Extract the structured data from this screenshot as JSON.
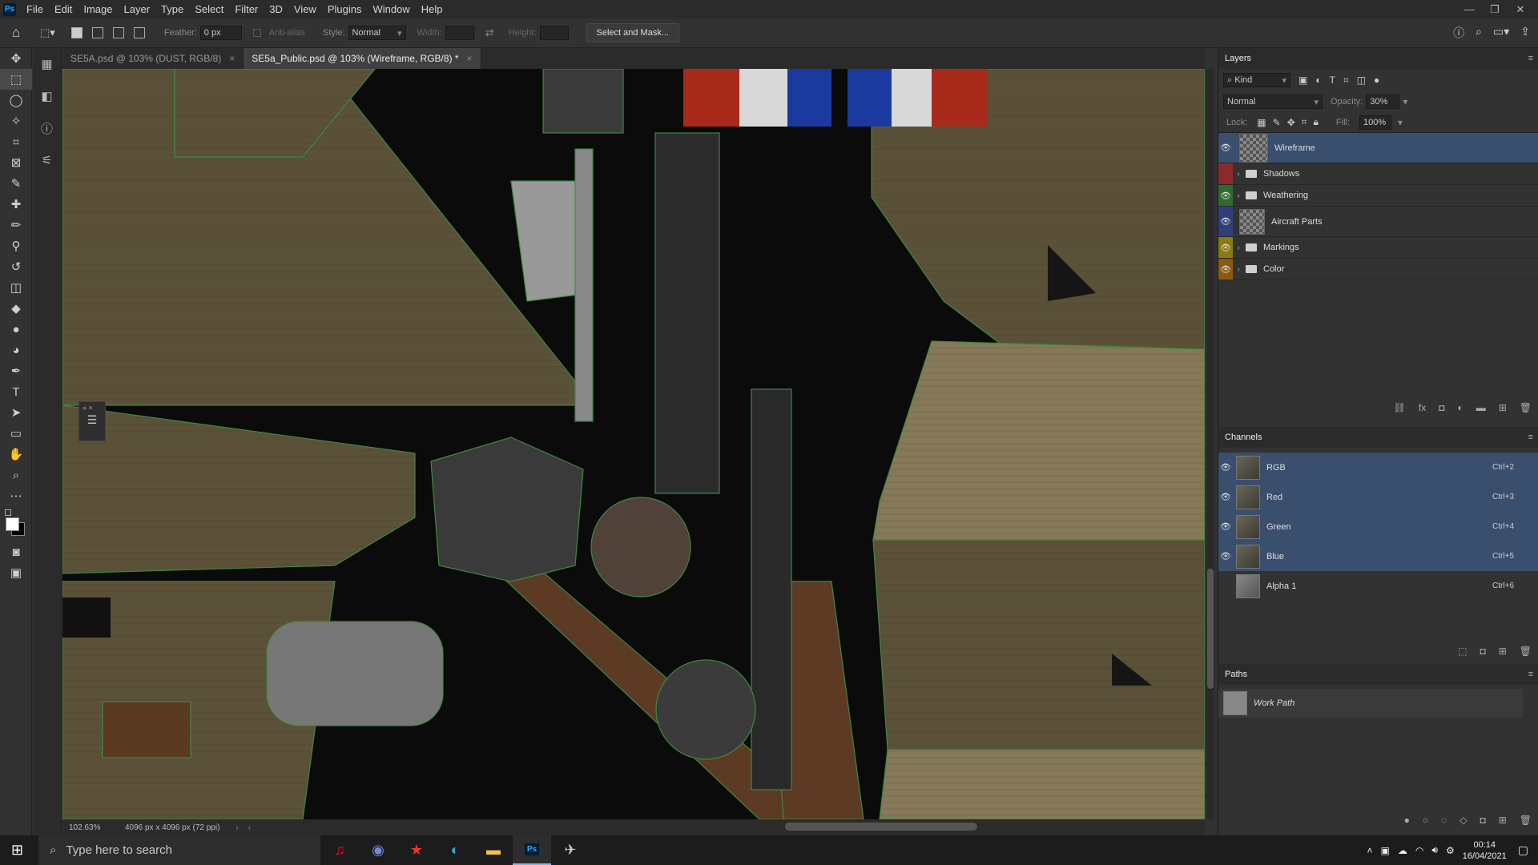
{
  "menu": {
    "logo": "Ps",
    "items": [
      "File",
      "Edit",
      "Image",
      "Layer",
      "Type",
      "Select",
      "Filter",
      "3D",
      "View",
      "Plugins",
      "Window",
      "Help"
    ]
  },
  "options": {
    "feather_label": "Feather:",
    "feather_value": "0 px",
    "antialias_label": "Anti-alias",
    "style_label": "Style:",
    "style_value": "Normal",
    "width_label": "Width:",
    "height_label": "Height:",
    "select_mask": "Select and Mask..."
  },
  "tabs": [
    {
      "label": "SE5A.psd @ 103% (DUST, RGB/8)"
    },
    {
      "label": "SE5a_Public.psd @ 103% (Wireframe, RGB/8) *"
    }
  ],
  "status": {
    "zoom": "102.63%",
    "docsize": "4096 px x 4096 px (72 ppi)"
  },
  "layers_panel": {
    "title": "Layers",
    "kind": "Kind",
    "blend": "Normal",
    "opacity_label": "Opacity:",
    "opacity": "30%",
    "lock_label": "Lock:",
    "fill_label": "Fill:",
    "fill": "100%",
    "layers": [
      {
        "name": "Wireframe"
      },
      {
        "name": "Shadows"
      },
      {
        "name": "Weathering"
      },
      {
        "name": "Aircraft Parts"
      },
      {
        "name": "Markings"
      },
      {
        "name": "Color"
      }
    ]
  },
  "channels_panel": {
    "title": "Channels",
    "channels": [
      {
        "name": "RGB",
        "shortcut": "Ctrl+2"
      },
      {
        "name": "Red",
        "shortcut": "Ctrl+3"
      },
      {
        "name": "Green",
        "shortcut": "Ctrl+4"
      },
      {
        "name": "Blue",
        "shortcut": "Ctrl+5"
      },
      {
        "name": "Alpha 1",
        "shortcut": "Ctrl+6"
      }
    ]
  },
  "paths_panel": {
    "title": "Paths",
    "paths": [
      {
        "name": "Work Path"
      }
    ]
  },
  "taskbar": {
    "search_placeholder": "Type here to search",
    "time": "00:14",
    "date": "16/04/2021"
  },
  "colors": {
    "selection": "#3a4e6e",
    "canvas": "#0b0b0b",
    "fabric": "#5a5138"
  }
}
